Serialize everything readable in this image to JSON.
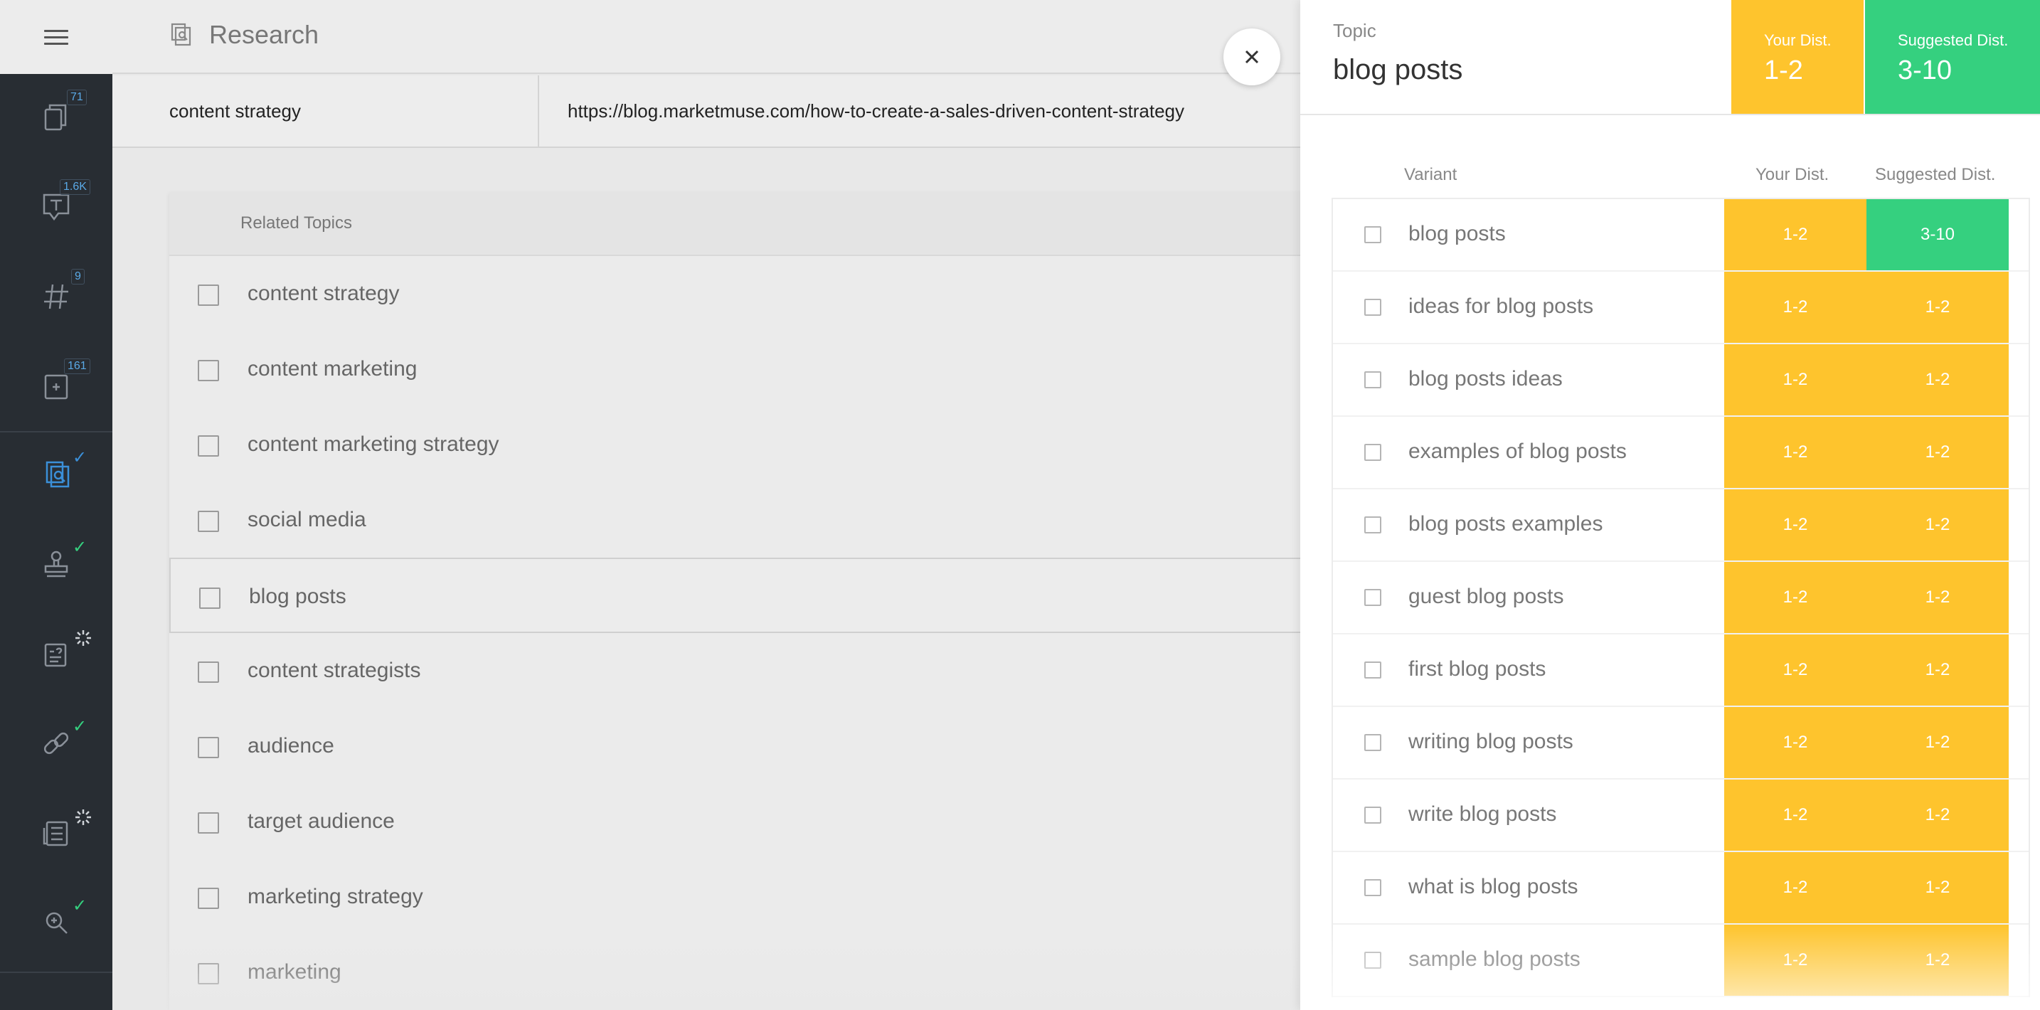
{
  "header": {
    "title": "Research"
  },
  "inputs": {
    "focus_topic": "content strategy",
    "url": "https://blog.marketmuse.com/how-to-create-a-sales-driven-content-strategy"
  },
  "sidebar": {
    "items": [
      {
        "icon": "documents-icon",
        "badge": "71"
      },
      {
        "icon": "topic-text-icon",
        "badge": "1.6K"
      },
      {
        "icon": "hashtag-icon",
        "badge": "9"
      },
      {
        "icon": "add-page-icon",
        "badge": "161"
      },
      {
        "icon": "research-icon",
        "status": "✓"
      },
      {
        "icon": "stamp-icon",
        "status": "✓"
      },
      {
        "icon": "questions-icon",
        "status": "loading"
      },
      {
        "icon": "link-icon",
        "status": "✓"
      },
      {
        "icon": "news-icon",
        "status": "loading"
      },
      {
        "icon": "search-analysis-icon",
        "status": "✓"
      }
    ],
    "colors": {
      "background": "#282d33",
      "active": "#3b8fd8",
      "check": "#35d07f"
    }
  },
  "related_topics": {
    "header": "Related Topics",
    "items": [
      "content strategy",
      "content marketing",
      "content marketing strategy",
      "social media",
      "blog posts",
      "content strategists",
      "audience",
      "target audience",
      "marketing strategy",
      "marketing"
    ],
    "selected": "blog posts"
  },
  "panel": {
    "topic_label": "Topic",
    "topic": "blog posts",
    "your_dist_label": "Your Dist.",
    "your_dist": "1-2",
    "suggested_dist_label": "Suggested Dist.",
    "suggested_dist": "3-10",
    "columns": {
      "variant": "Variant",
      "your": "Your Dist.",
      "suggested": "Suggested Dist."
    },
    "variants": [
      {
        "name": "blog posts",
        "your": "1-2",
        "suggested": "3-10"
      },
      {
        "name": "ideas for blog posts",
        "your": "1-2",
        "suggested": "1-2"
      },
      {
        "name": "blog posts ideas",
        "your": "1-2",
        "suggested": "1-2"
      },
      {
        "name": "examples of blog posts",
        "your": "1-2",
        "suggested": "1-2"
      },
      {
        "name": "blog posts examples",
        "your": "1-2",
        "suggested": "1-2"
      },
      {
        "name": "guest blog posts",
        "your": "1-2",
        "suggested": "1-2"
      },
      {
        "name": "first blog posts",
        "your": "1-2",
        "suggested": "1-2"
      },
      {
        "name": "writing blog posts",
        "your": "1-2",
        "suggested": "1-2"
      },
      {
        "name": "write blog posts",
        "your": "1-2",
        "suggested": "1-2"
      },
      {
        "name": "what is blog posts",
        "your": "1-2",
        "suggested": "1-2"
      },
      {
        "name": "sample blog posts",
        "your": "1-2",
        "suggested": "1-2"
      }
    ],
    "colors": {
      "yellow": "#fec42d",
      "green": "#35d07f"
    }
  }
}
